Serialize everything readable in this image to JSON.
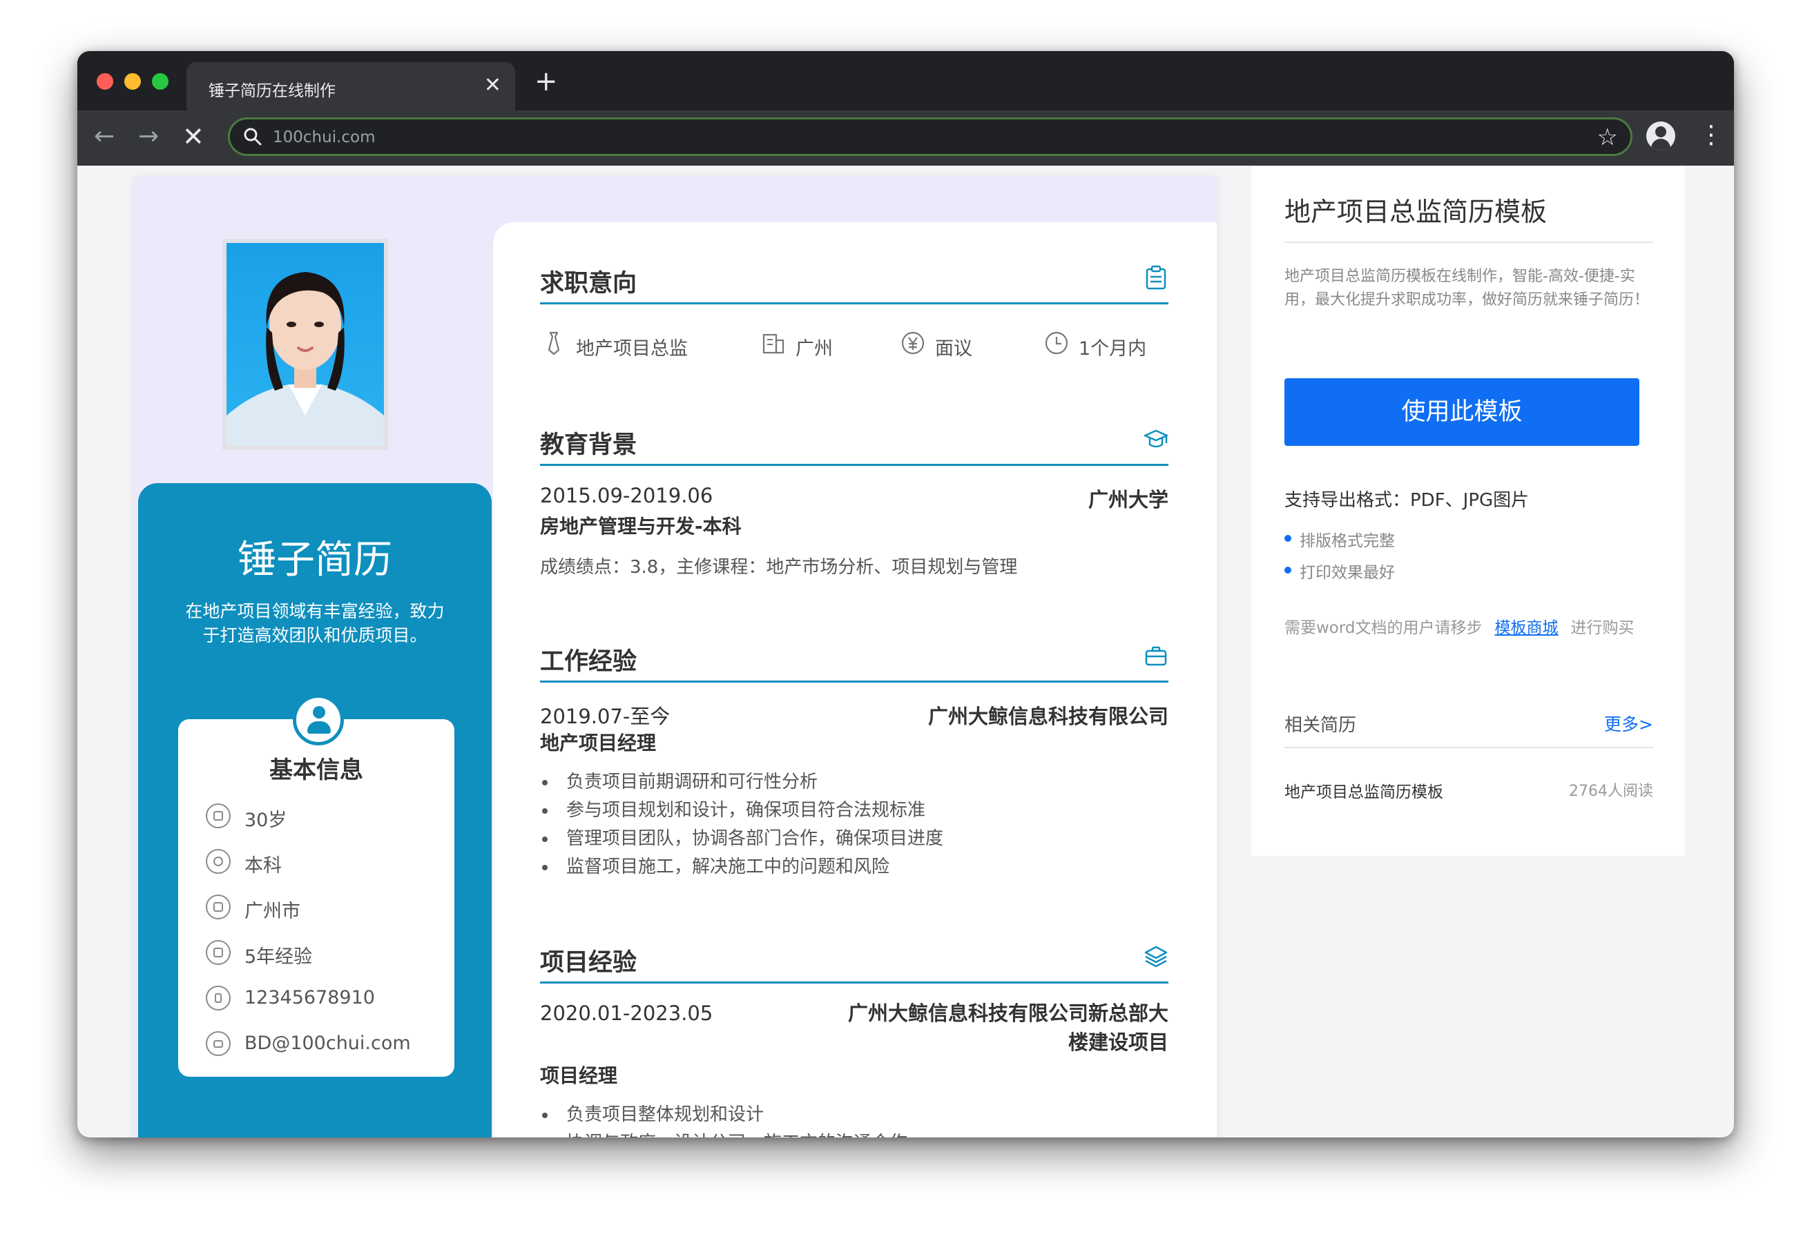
{
  "browser": {
    "tab_title": "锤子简历在线制作",
    "tab_close": "✕",
    "new_tab": "+",
    "back": "←",
    "forward": "→",
    "stop": "✕",
    "url": "100chui.com",
    "star": "☆",
    "menu": "⋮"
  },
  "resume": {
    "name": "锤子简历",
    "summary": "在地产项目领域有丰富经验，致力于打造高效团队和优质项目。",
    "basic_title": "基本信息",
    "basic_info": [
      "30岁",
      "本科",
      "广州市",
      "5年经验",
      "12345678910",
      "BD@100chui.com"
    ],
    "intent": {
      "title": "求职意向",
      "position": "地产项目总监",
      "city": "广州",
      "salary": "面议",
      "availability": "1个月内"
    },
    "education": {
      "title": "教育背景",
      "period": "2015.09-2019.06",
      "school": "广州大学",
      "major": "房地产管理与开发-本科",
      "detail": "成绩绩点：3.8，主修课程：地产市场分析、项目规划与管理"
    },
    "work": {
      "title": "工作经验",
      "period": "2019.07-至今",
      "company": "广州大鲸信息科技有限公司",
      "role": "地产项目经理",
      "bullets": [
        "负责项目前期调研和可行性分析",
        "参与项目规划和设计，确保项目符合法规标准",
        "管理项目团队，协调各部门合作，确保项目进度",
        "监督项目施工，解决施工中的问题和风险"
      ]
    },
    "project": {
      "title": "项目经验",
      "period": "2020.01-2023.05",
      "name": "广州大鲸信息科技有限公司新总部大楼建设项目",
      "role": "项目经理",
      "bullets": [
        "负责项目整体规划和设计",
        "协调与政府、设计公司、施工方的沟通合作"
      ]
    }
  },
  "sidebar": {
    "title": "地产项目总监简历模板",
    "description": "地产项目总监简历模板在线制作，智能-高效-便捷-实用，最大化提升求职成功率，做好简历就来锤子简历！",
    "use_button": "使用此模板",
    "export_formats": "支持导出格式：PDF、JPG图片",
    "features": [
      "排版格式完整",
      "打印效果最好"
    ],
    "word_note_prefix": "需要word文档的用户请移步",
    "word_note_link": "模板商城",
    "word_note_suffix": "进行购买",
    "related_title": "相关简历",
    "more_link": "更多>",
    "related_items": [
      {
        "name": "地产项目总监简历模板",
        "reads": "2764人阅读"
      }
    ]
  },
  "colors": {
    "accent": "#0e8fbe",
    "button": "#0f6ef3",
    "resume_bg": "#ece9fb"
  }
}
